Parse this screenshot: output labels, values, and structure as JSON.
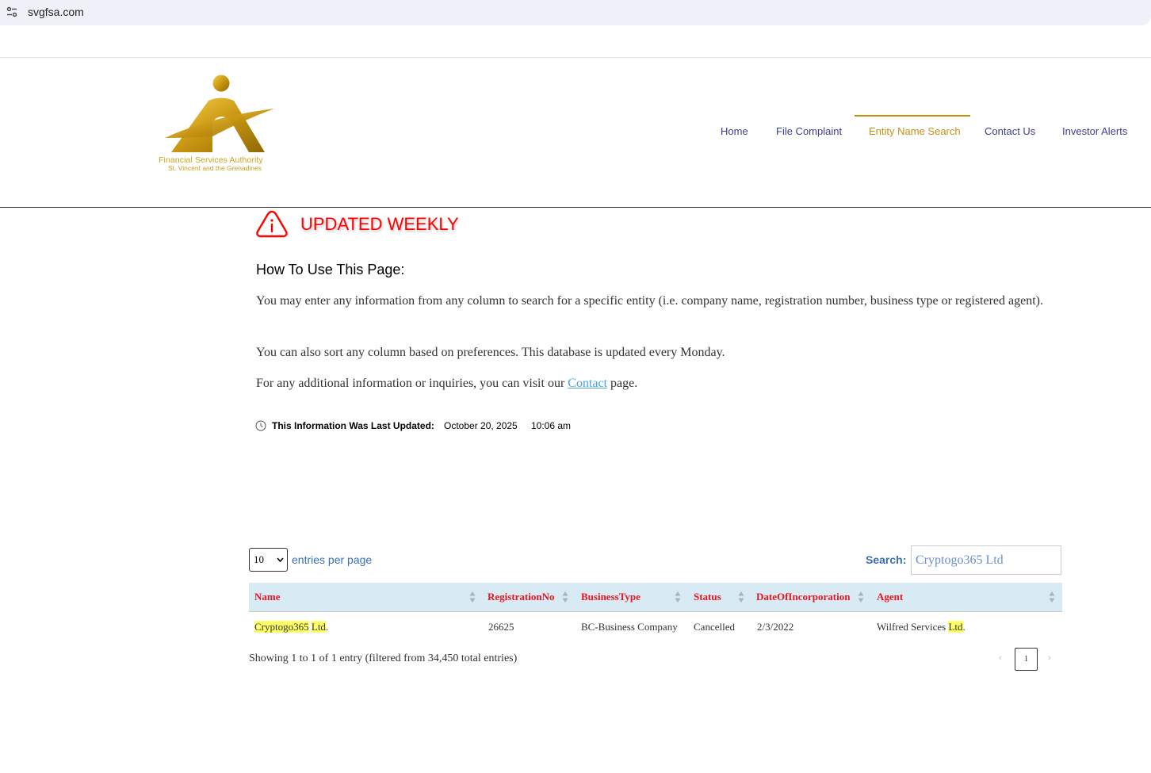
{
  "browser": {
    "url": "svgfsa.com",
    "site_info_icon": "tune-icon"
  },
  "logo": {
    "line1": "Financial Services Authority",
    "line2": "St. Vincent and the Grenadines",
    "color": "#c9a21a"
  },
  "nav": {
    "items": [
      {
        "label": "Home"
      },
      {
        "label": "File Complaint"
      },
      {
        "label": "Entity Name Search",
        "active": true
      },
      {
        "label": "Contact Us"
      },
      {
        "label": "Investor Alerts"
      }
    ],
    "color": "#3d3d8f",
    "active_color": "#c49014"
  },
  "alert": {
    "icon": "info-warning-icon",
    "text": "UPDATED WEEKLY",
    "color": "#ff0000"
  },
  "howto": {
    "heading": "How To Use This Page:",
    "p1": "You may enter any information from any column to search for a specific entity (i.e. company name, registration number, business type or registered agent).",
    "p2": "You can also sort any column based on preferences. This database is updated every Monday.",
    "p3_before": "For any additional information or inquiries, you can visit our ",
    "p3_link": "Contact",
    "p3_after": " page."
  },
  "last_updated": {
    "icon": "clock-icon",
    "label": "This Information Was Last Updated:",
    "date": "October 20, 2025",
    "time": "10:06 am"
  },
  "table_controls": {
    "page_length": "10",
    "page_length_label": "entries per page",
    "search_label": "Search:",
    "search_value": "Cryptogo365 Ltd"
  },
  "table": {
    "headers": [
      "Name",
      "RegistrationNo",
      "BusinessType",
      "Status",
      "DateOfIncorporation",
      "Agent"
    ],
    "rows": [
      {
        "name_hl1": "Cryptogo365",
        "name_hl2": "Ltd",
        "name_tail": ".",
        "registration_no": "26625",
        "business_type": "BC-Business Company",
        "status": "Cancelled",
        "date_of_incorporation": "2/3/2022",
        "agent_before": "Wilfred Services ",
        "agent_hl": "Ltd",
        "agent_tail": "."
      }
    ],
    "header_color": "#e8141e",
    "header_bg": "#d8eaf4"
  },
  "footer": {
    "info": "Showing 1 to 1 of 1 entry (filtered from 34,450 total entries)",
    "prev": "‹",
    "current_page": "1",
    "next": "›"
  }
}
